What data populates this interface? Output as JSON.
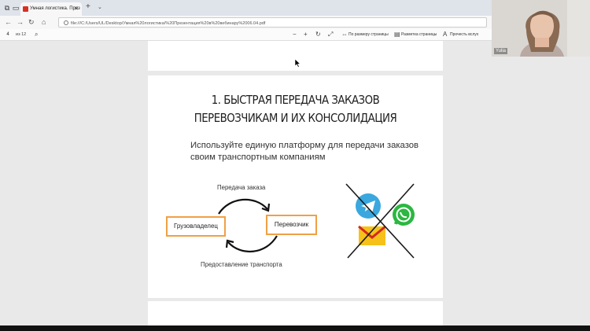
{
  "browser": {
    "tab_title": "Умная логистика. През",
    "tab_close": "✕",
    "new_tab": "+",
    "url": "file:///C:/Users/UL/Desktop/Умная%20логистика/%20Презентация%20в%20вебинару%2006.04.pdf"
  },
  "pdf_toolbar": {
    "page_number": "4",
    "page_count": "из 12",
    "fit_page_label": "По размеру страницы",
    "page_layout_label": "Разметка страницы",
    "read_aloud_label": "Прочесть вслух"
  },
  "slide": {
    "title_line1": "1. БЫСТРАЯ ПЕРЕДАЧА ЗАКАЗОВ",
    "title_line2": "ПЕРЕВОЗЧИКАМ И ИХ КОНСОЛИДАЦИЯ",
    "subtitle": "Используйте единую платформу для передачи заказов своим транспортным компаниям",
    "flow": {
      "top_label": "Передача заказа",
      "left_box": "Грузовладелец",
      "right_box": "Перевозчик",
      "bottom_label": "Предоставление транспорта"
    }
  },
  "webcam": {
    "participant_name": "Yulia"
  },
  "colors": {
    "accent_orange": "#f0a046",
    "telegram": "#3aa8de",
    "whatsapp": "#2bb741",
    "mail_yellow": "#f6c21a",
    "mail_red": "#d32a1f"
  },
  "icons": {
    "telegram": "telegram-icon",
    "whatsapp": "whatsapp-icon",
    "mail": "mail-icon",
    "cross": "cross-out-icon"
  }
}
